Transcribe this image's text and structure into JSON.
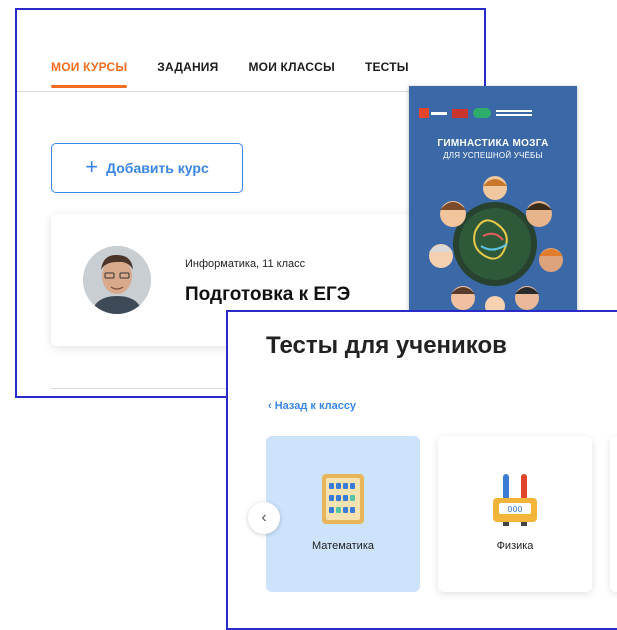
{
  "courses": {
    "tabs": [
      {
        "label": "МОИ КУРСЫ"
      },
      {
        "label": "ЗАДАНИЯ"
      },
      {
        "label": "МОИ КЛАССЫ"
      },
      {
        "label": "ТЕСТЫ"
      }
    ],
    "add_button": "Добавить курс",
    "card": {
      "subject": "Информатика, 11 класс",
      "title": "Подготовка к ЕГЭ"
    }
  },
  "book": {
    "title": "ГИМНАСТИКА МОЗГА",
    "subtitle": "ДЛЯ УСПЕШНОЙ УЧЁБЫ"
  },
  "tests": {
    "title": "Тесты для учеников",
    "back_link": "‹ Назад к классу",
    "subjects": [
      {
        "label": "Математика"
      },
      {
        "label": "Физика"
      }
    ]
  },
  "colors": {
    "accent_orange": "#f36c21",
    "link_blue": "#3a86e8",
    "frame_blue": "#2a2ac9",
    "selected_card": "#cce3fb"
  }
}
